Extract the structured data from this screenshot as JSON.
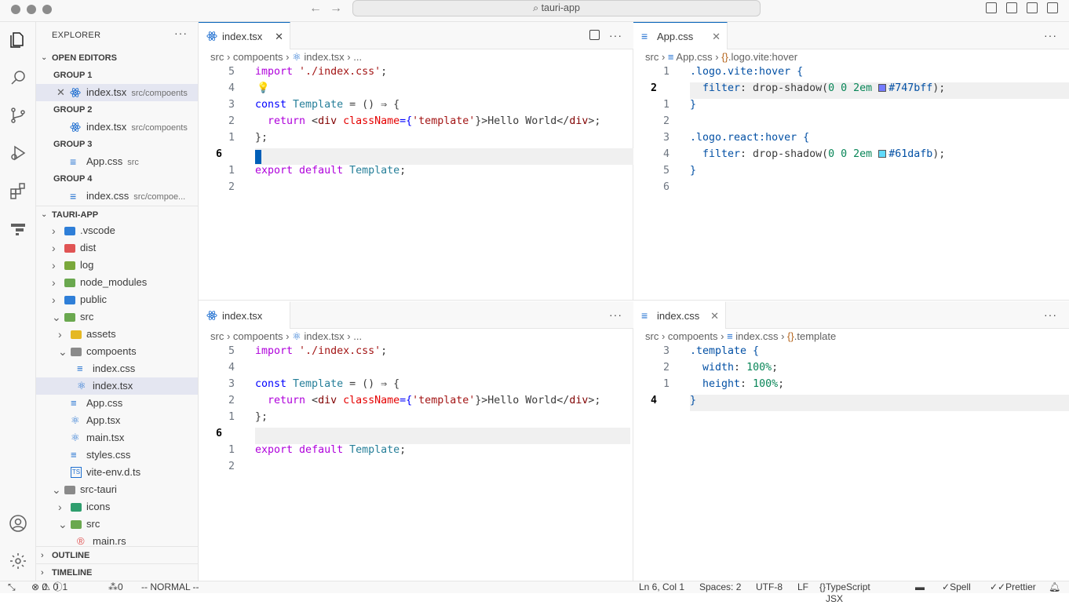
{
  "window": {
    "title": "tauri-app"
  },
  "sidebar": {
    "header": "EXPLORER",
    "open_editors": {
      "title": "OPEN EDITORS",
      "groups": [
        {
          "label": "GROUP 1",
          "file": "index.tsx",
          "desc": "src/compoents"
        },
        {
          "label": "GROUP 2",
          "file": "index.tsx",
          "desc": "src/compoents"
        },
        {
          "label": "GROUP 3",
          "file": "App.css",
          "desc": "src"
        },
        {
          "label": "GROUP 4",
          "file": "index.css",
          "desc": "src/compoe..."
        }
      ]
    },
    "project": {
      "title": "TAURI-APP",
      "items": [
        ".vscode",
        "dist",
        "log",
        "node_modules",
        "public",
        "src",
        "assets",
        "compoents",
        "index.css",
        "index.tsx",
        "App.css",
        "App.tsx",
        "main.tsx",
        "styles.css",
        "vite-env.d.ts",
        "src-tauri",
        "icons",
        "src",
        "main.rs"
      ]
    },
    "outline": "OUTLINE",
    "timeline": "TIMELINE"
  },
  "editors": {
    "top_left": {
      "tab": "index.tsx",
      "breadcrumb": [
        "src",
        "compoents",
        "index.tsx",
        "..."
      ],
      "line_numbers": [
        "5",
        "4",
        "3",
        "2",
        "1",
        "6",
        "1",
        "2"
      ],
      "lines": {
        "l0_a": "import",
        "l0_b": " './index.css'",
        "l0_c": ";",
        "l2_a": "const",
        "l2_b": " Template",
        "l2_c": " = () ⇒ {",
        "l3_a": "  return",
        "l3_b": " <",
        "l3_c": "div",
        "l3_d": " className",
        "l3_e": "={",
        "l3_f": "'template'",
        "l3_g": "}>Hello World</",
        "l3_h": "div",
        "l3_i": ">;",
        "l4": "};",
        "l6_a": "export",
        "l6_b": " default",
        "l6_c": " Template",
        "l6_d": ";"
      }
    },
    "top_right": {
      "tab": "App.css",
      "breadcrumb": [
        "src",
        "App.css",
        ".logo.vite:hover"
      ],
      "line_numbers": [
        "1",
        "2",
        "1",
        "2",
        "3",
        "4",
        "5",
        "6"
      ],
      "lines": {
        "l0": ".logo.vite:hover {",
        "l1_a": "  filter",
        "l1_b": ": drop-shadow(",
        "l1_c": "0 0 2em",
        "l1_d": "#747bff",
        "l1_e": ");",
        "l2": "}",
        "l4": ".logo.react:hover {",
        "l5_a": "  filter",
        "l5_b": ": drop-shadow(",
        "l5_c": "0 0 2em",
        "l5_d": "#61dafb",
        "l5_e": ");",
        "l6": "}"
      },
      "swatch_colors": [
        "#747bff",
        "#61dafb"
      ]
    },
    "bottom_left": {
      "tab": "index.tsx",
      "breadcrumb": [
        "src",
        "compoents",
        "index.tsx",
        "..."
      ],
      "line_numbers": [
        "5",
        "4",
        "3",
        "2",
        "1",
        "6",
        "1",
        "2"
      ]
    },
    "bottom_right": {
      "tab": "index.css",
      "breadcrumb": [
        "src",
        "compoents",
        "index.css",
        ".template"
      ],
      "line_numbers": [
        "3",
        "2",
        "1",
        "4"
      ],
      "lines": {
        "l0": ".template {",
        "l1_a": "  width",
        "l1_b": ": ",
        "l1_c": "100%",
        "l1_d": ";",
        "l2_a": "  height",
        "l2_b": ": ",
        "l2_c": "100%",
        "l2_d": ";",
        "l3": "}"
      }
    }
  },
  "statusbar": {
    "errors": "0",
    "warnings": "0",
    "info": "1",
    "ports": "0",
    "mode": "-- NORMAL --",
    "position": "Ln 6, Col 1",
    "spaces": "Spaces: 2",
    "encoding": "UTF-8",
    "eol": "LF",
    "language": "TypeScript JSX",
    "spell": "Spell",
    "prettier": "Prettier"
  },
  "colors": {
    "accent": "#005fb8",
    "react": "#0e639c",
    "css": "#1f6fd0"
  }
}
